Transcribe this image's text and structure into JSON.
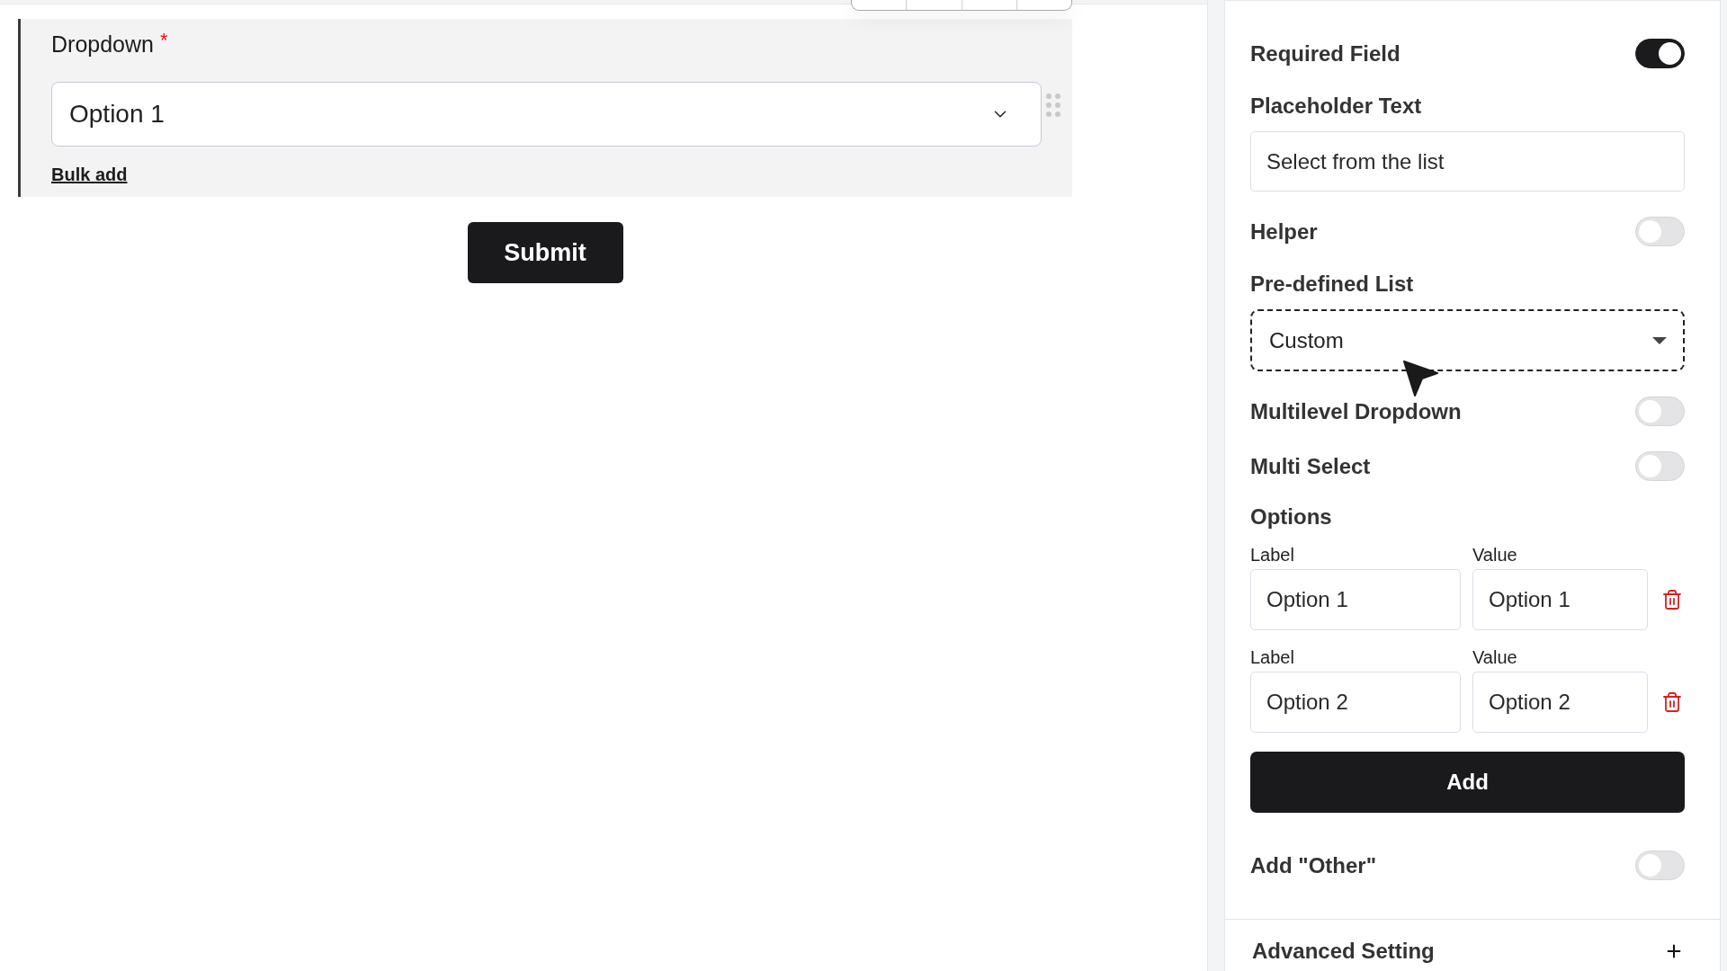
{
  "form_canvas": {
    "field": {
      "label": "Dropdown",
      "required_mark": "*",
      "value": "Option 1",
      "bulk_add_link": "Bulk add"
    },
    "submit_button": "Submit"
  },
  "settings_panel": {
    "items": [
      {
        "kind": "toggle",
        "label": "Required Field",
        "on": true
      },
      {
        "kind": "text_input",
        "label": "Placeholder Text",
        "value": "Select from the list"
      },
      {
        "kind": "toggle",
        "label": "Helper",
        "on": false
      },
      {
        "kind": "select",
        "label": "Pre-defined List",
        "value": "Custom"
      },
      {
        "kind": "toggle",
        "label": "Multilevel Dropdown",
        "on": false
      },
      {
        "kind": "toggle",
        "label": "Multi Select",
        "on": false
      },
      {
        "kind": "options",
        "label": "Options",
        "rows": [
          {
            "label_heading": "Label",
            "label": "Option 1",
            "value_heading": "Value",
            "value": "Option 1"
          },
          {
            "label_heading": "Label",
            "label": "Option 2",
            "value_heading": "Value",
            "value": "Option 2"
          }
        ],
        "add_button": "Add"
      },
      {
        "kind": "toggle",
        "label": "Add \"Other\"",
        "on": false
      }
    ],
    "advanced_section": {
      "title": "Advanced Setting",
      "expanded": false
    }
  }
}
